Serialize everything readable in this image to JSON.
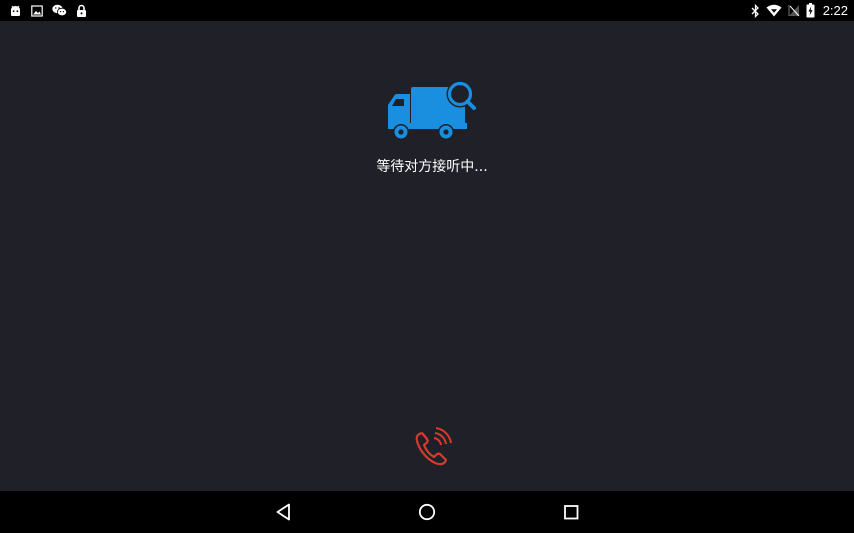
{
  "status_bar": {
    "left_icons": [
      "android-icon",
      "image-icon",
      "wechat-icon",
      "lock-icon"
    ],
    "right_icons": [
      "bluetooth-icon",
      "wifi-icon",
      "no-sim-icon",
      "battery-charging-icon"
    ],
    "time": "2:22"
  },
  "call": {
    "status_text": "等待对方接听中...",
    "truck_icon": "truck-search-icon",
    "hangup_icon": "phone-hangup-icon"
  },
  "nav_bar": {
    "back": "back-triangle-icon",
    "home": "home-circle-icon",
    "recents": "recents-square-icon"
  },
  "colors": {
    "background": "#1f2028",
    "bars": "#000000",
    "truck_blue": "#1a8fe0",
    "hangup_red": "#d93a2b",
    "text": "#ffffff"
  }
}
